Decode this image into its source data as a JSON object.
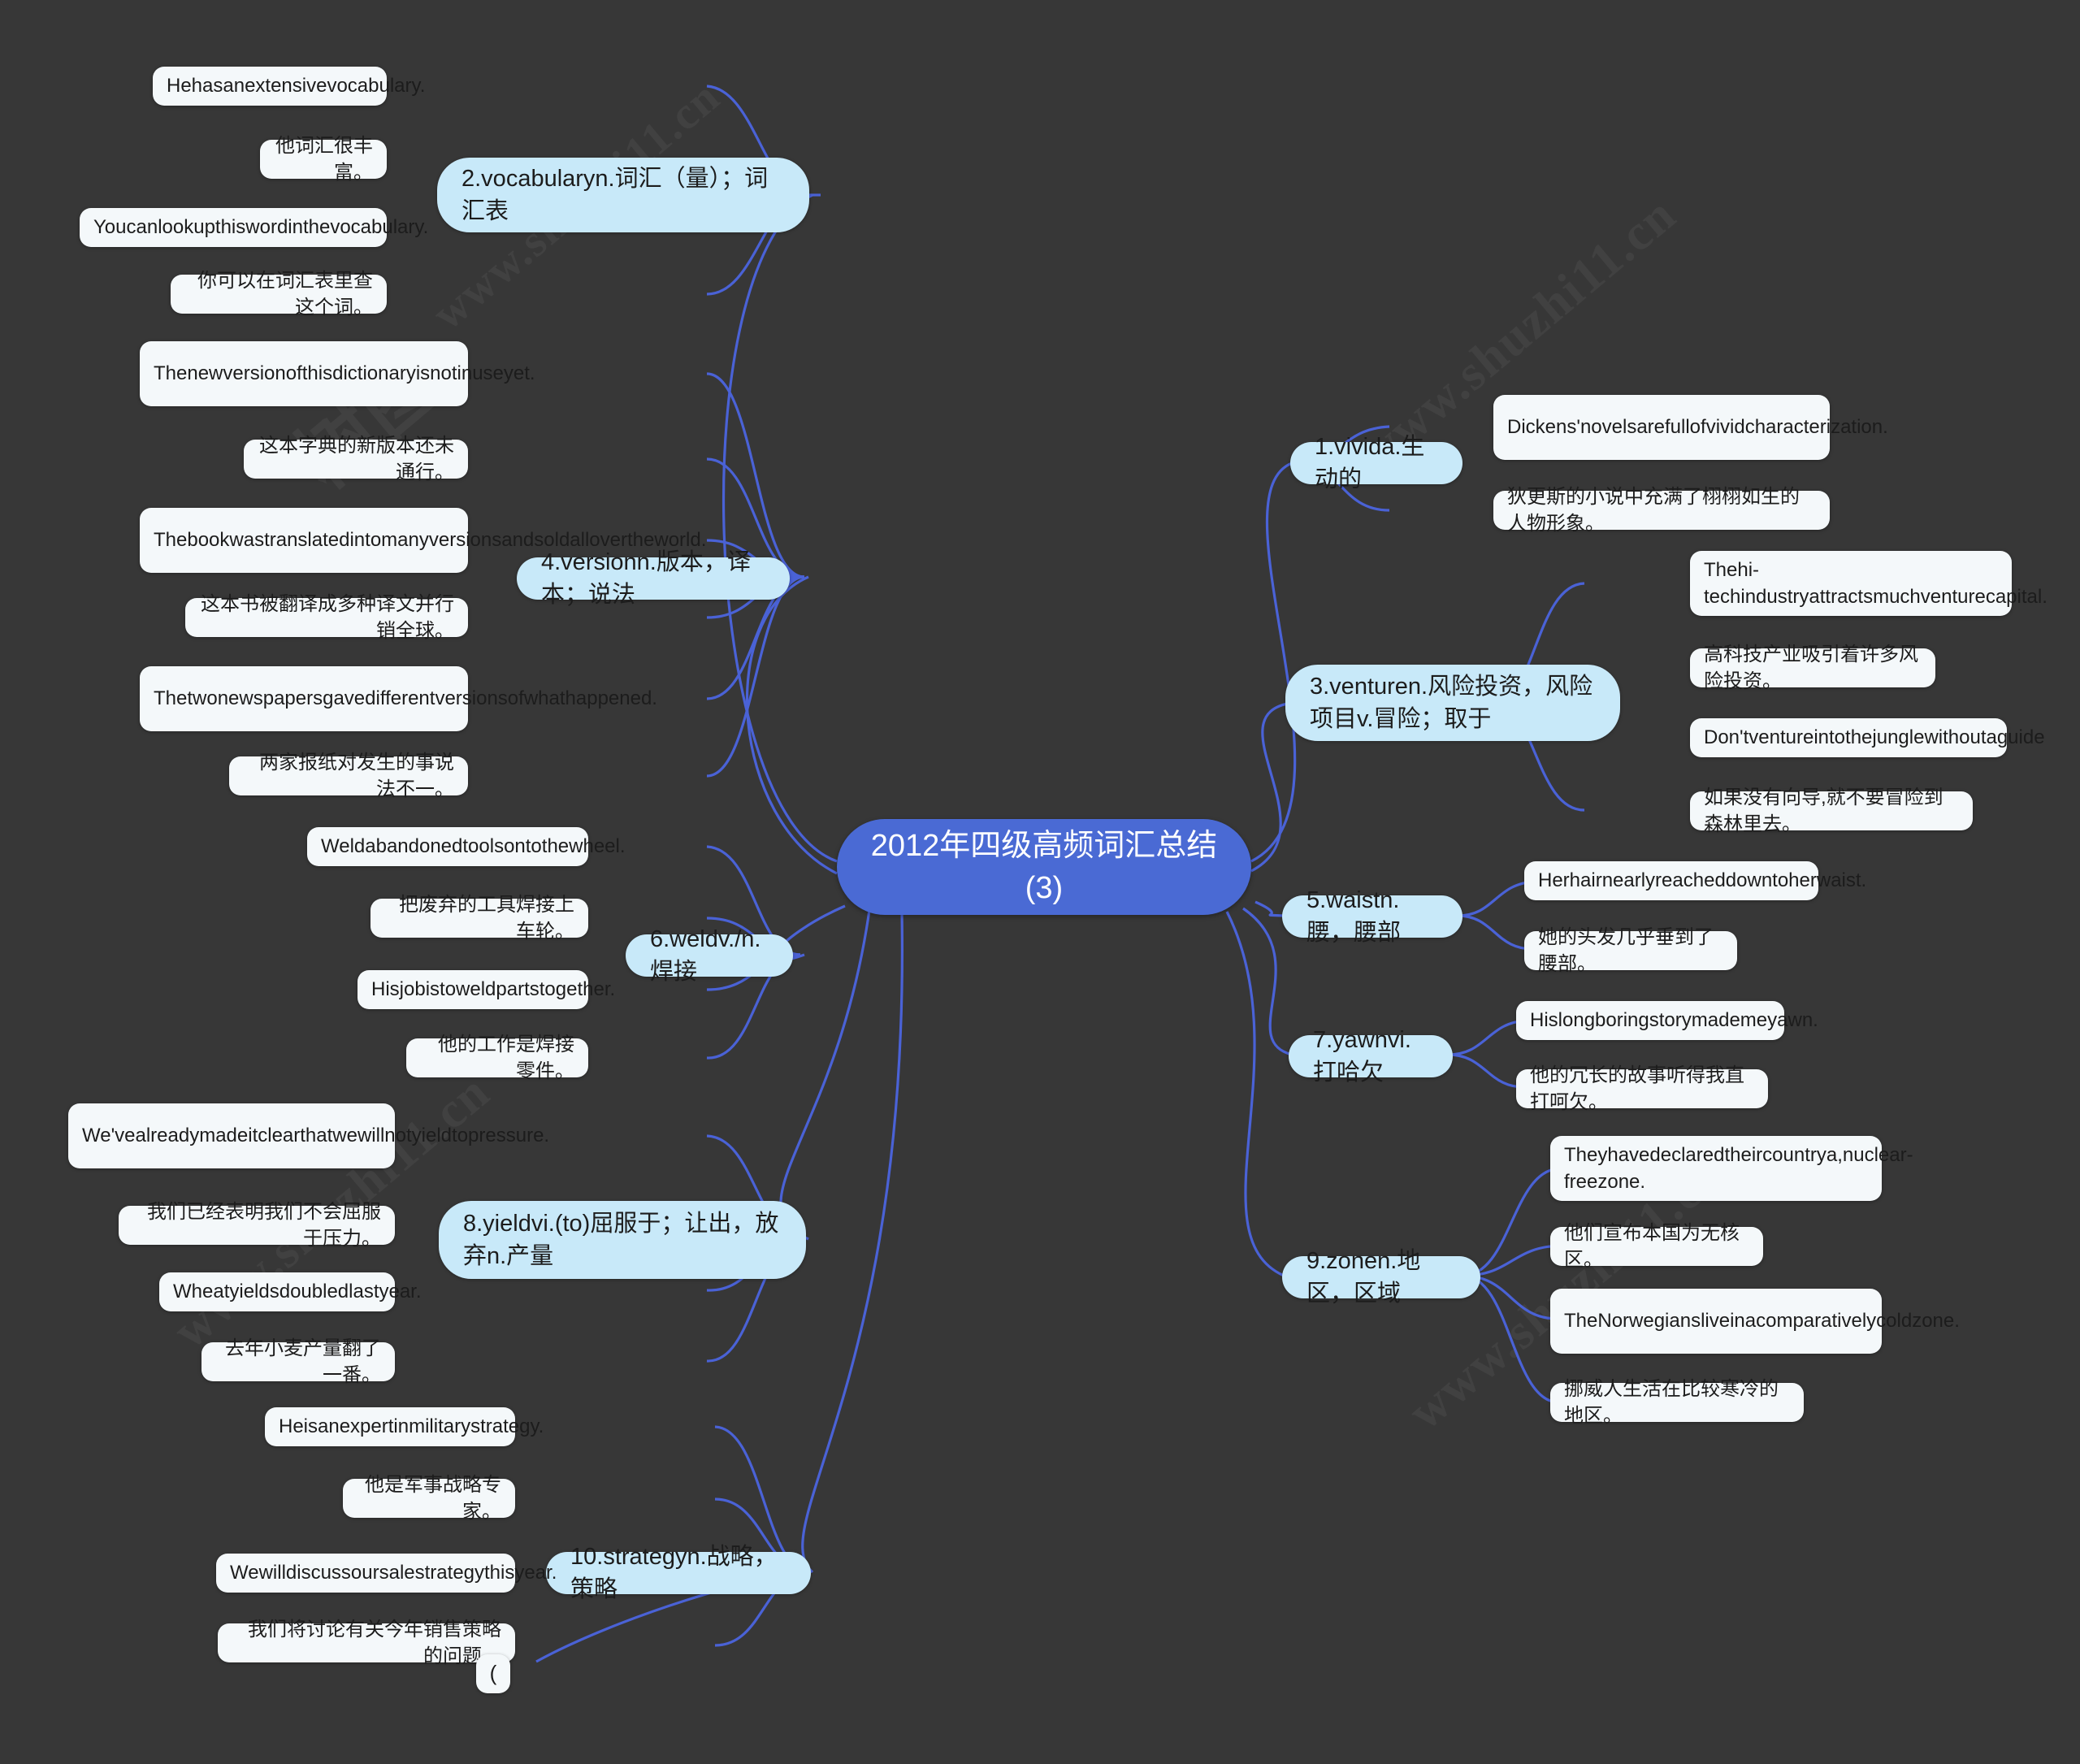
{
  "theme": {
    "background": "#373737",
    "root_fill": "#4a6ad4",
    "root_text": "#ffffff",
    "branch_fill": "#c8e9f9",
    "leaf_fill": "#f4f8fa",
    "text": "#1c1c1c",
    "link": "#4a62d6"
  },
  "watermarks": [
    "www.shuzhi11.cn",
    "树图",
    "www.shuzhi11.cn",
    "www.shuzhi11.cn"
  ],
  "mindmap": {
    "root": "2012年四级高频词汇总结\n(3)",
    "root_line1": "2012年四级高频词汇总结",
    "root_line2": "(3)",
    "branches": [
      {
        "id": "vivid",
        "label": "1.vivida.生动的",
        "side": "right",
        "children": [
          "Dickens'novelsarefullofvividcharacterization.",
          "狄更斯的小说中充满了栩栩如生的人物形象。"
        ]
      },
      {
        "id": "vocabulary",
        "label": "2.vocabularyn.词汇（量）；词汇表",
        "side": "left",
        "children": [
          "Hehasanextensivevocabulary.",
          "他词汇很丰富。",
          "Youcanlookupthiswordinthevocabulary.",
          "你可以在词汇表里查这个词。"
        ]
      },
      {
        "id": "venture",
        "label": "3.venturen.风险投资，风险项目v.冒险；取于",
        "side": "right",
        "children": [
          "Thehi-techindustryattractsmuchventurecapital.",
          "高科技产业吸引着许多风险投资。",
          "Don'tventureintothejunglewithoutaguide",
          "如果没有向导,就不要冒险到森林里去。"
        ]
      },
      {
        "id": "version",
        "label": "4.versionn.版本，译本；说法",
        "side": "left",
        "children": [
          "Thenewversionofthisdictionaryisnotinuseyet.",
          "这本字典的新版本还未通行。",
          "Thebookwastranslatedintomanyversionsandsoldallovertheworld.",
          "这本书被翻译成多种译文并行销全球。",
          "Thetwonewspapersgavedifferentversionsofwhathappened.",
          "两家报纸对发生的事说法不一。"
        ]
      },
      {
        "id": "waist",
        "label": "5.waistn.腰，腰部",
        "side": "right",
        "children": [
          "Herhairnearlyreacheddowntoherwaist.",
          "她的头发几乎垂到了腰部。"
        ]
      },
      {
        "id": "weld",
        "label": "6.weldv./n.焊接",
        "side": "left",
        "children": [
          "Weldabandonedtoolsontothewheel.",
          "把废弃的工具焊接上车轮。",
          "Hisjobistoweldpartstogether.",
          "他的工作是焊接零件。"
        ]
      },
      {
        "id": "yawn",
        "label": "7.yawnvi.打哈欠",
        "side": "right",
        "children": [
          "Hislongboringstorymademeyawn.",
          "他的冗长的故事听得我直打呵欠。"
        ]
      },
      {
        "id": "yield",
        "label": "8.yieldvi.(to)屈服于；让出，放弃n.产量",
        "side": "left",
        "children": [
          "We'vealreadymadeitclearthatwewillnotyieldtopressure.",
          "我们已经表明我们不会屈服于压力。",
          "Wheatyieldsdoubledlastyear.",
          "去年小麦产量翻了一番。"
        ]
      },
      {
        "id": "zone",
        "label": "9.zonen.地区，区域",
        "side": "right",
        "children": [
          "Theyhavedeclaredtheircountrya,nuclear-freezone.",
          "他们宣布本国为无核区。",
          "TheNorwegiansliveinacomparativelycoldzone.",
          "挪威人生活在比较寒冷的地区。"
        ]
      },
      {
        "id": "strategy",
        "label": "10.strategyn.战略，策略",
        "side": "left",
        "children": [
          "Heisanexpertinmilitarystrategy.",
          "他是军事战略专家。",
          "Wewilldiscussoursalestrategythisyear.",
          "我们将讨论有关今年销售策略的问题。",
          "("
        ]
      }
    ]
  }
}
